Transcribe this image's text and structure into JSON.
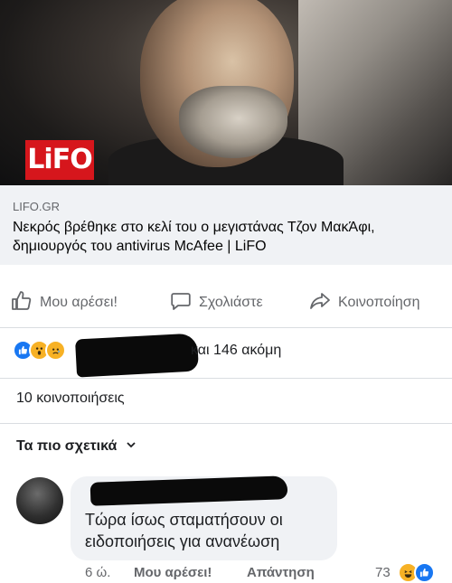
{
  "post": {
    "image_logo": "LiFO",
    "link_domain": "LIFO.GR",
    "link_title": "Νεκρός βρέθηκε στο κελί του ο μεγιστάνας Τζον ΜακΆφι, δημιουργός του antivirus McAfee | LiFO"
  },
  "actions": {
    "like_label": "Μου αρέσει!",
    "comment_label": "Σχολιάστε",
    "share_label": "Κοινοποίηση"
  },
  "summary": {
    "reactions_text": "και 146 ακόμη",
    "shares_text": "10 κοινοποιήσεις"
  },
  "comments": {
    "filter_label": "Τα πιο σχετικά",
    "item": {
      "text": "Τώρα ίσως σταματήσουν οι ειδοποιήσεις για ανανέωση",
      "time": "6 ώ.",
      "like_label": "Μου αρέσει!",
      "reply_label": "Απάντηση",
      "reaction_count": "73"
    }
  },
  "colors": {
    "like_blue": "#1877f2",
    "reaction_yellow": "#f7b125",
    "logo_red": "#d6161c"
  },
  "icons": {
    "like": "thumbs-up-icon",
    "comment": "speech-bubble-icon",
    "share": "share-arrow-icon",
    "chevron": "chevron-down-icon"
  }
}
